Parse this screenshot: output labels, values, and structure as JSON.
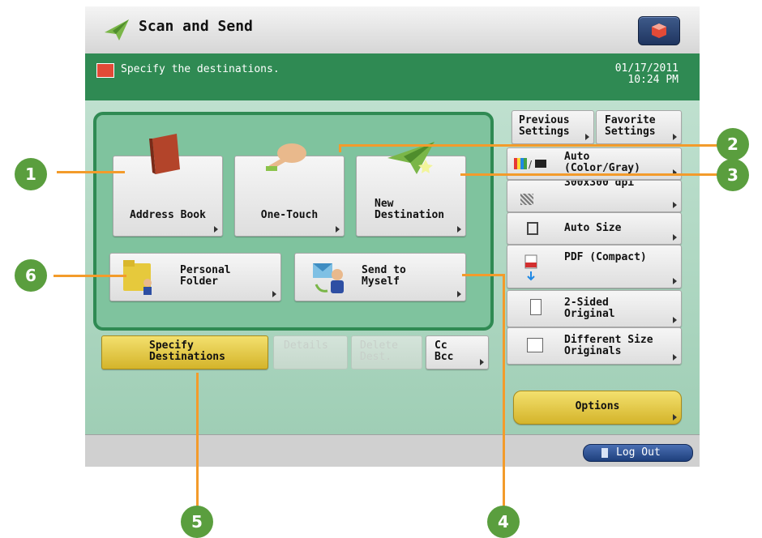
{
  "header": {
    "title": "Scan and Send",
    "icon": "paper-plane-icon"
  },
  "message": {
    "text": "Specify the destinations.",
    "date": "01/17/2011",
    "time": "10:24 PM"
  },
  "destinations": {
    "address_book": "Address Book",
    "one_touch": "One-Touch",
    "new_destination_1": "New",
    "new_destination_2": "Destination",
    "personal_folder_1": "Personal",
    "personal_folder_2": "Folder",
    "send_to_myself_1": "Send to",
    "send_to_myself_2": "Myself"
  },
  "actions": {
    "specify_1": "Specify",
    "specify_2": "Destinations",
    "details": "Details",
    "delete_1": "Delete",
    "delete_2": "Dest.",
    "cc_1": "Cc",
    "cc_2": "Bcc"
  },
  "settings": {
    "previous_1": "Previous",
    "previous_2": "Settings",
    "favorite_1": "Favorite",
    "favorite_2": "Settings",
    "color_1": "Auto",
    "color_2": "(Color/Gray)",
    "resolution": "300x300 dpi",
    "size": "Auto Size",
    "format": "PDF (Compact)",
    "sided_1": "2-Sided",
    "sided_2": "Original",
    "diff_1": "Different Size",
    "diff_2": "Originals",
    "options": "Options"
  },
  "footer": {
    "logout": "Log Out"
  },
  "callouts": [
    "1",
    "2",
    "3",
    "4",
    "5",
    "6"
  ],
  "colors": {
    "accent": "#2f8a53",
    "callout_line": "#f39b2b",
    "callout_badge": "#5a9e3e",
    "highlight": "#e6c84a"
  }
}
